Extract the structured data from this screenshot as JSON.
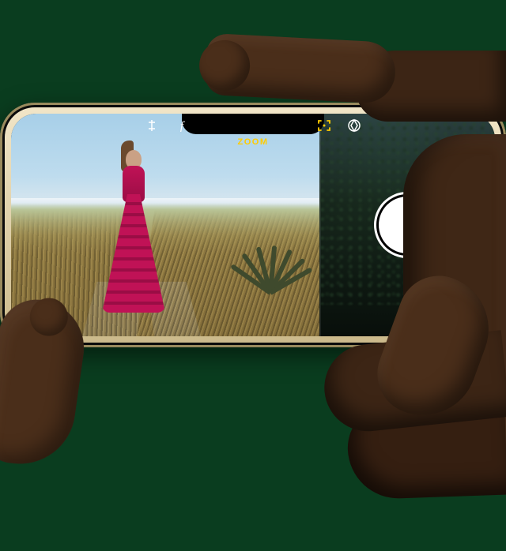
{
  "camera": {
    "zoom_label": "ZOOM",
    "zoom_color": "#ffcc00",
    "toolbar": {
      "left": [
        {
          "name": "exposure-icon"
        },
        {
          "name": "f-stop-icon"
        }
      ],
      "right": [
        {
          "name": "zoom-frame-icon",
          "active": true
        },
        {
          "name": "filters-icon"
        }
      ]
    },
    "shutter": "shutter-button"
  }
}
